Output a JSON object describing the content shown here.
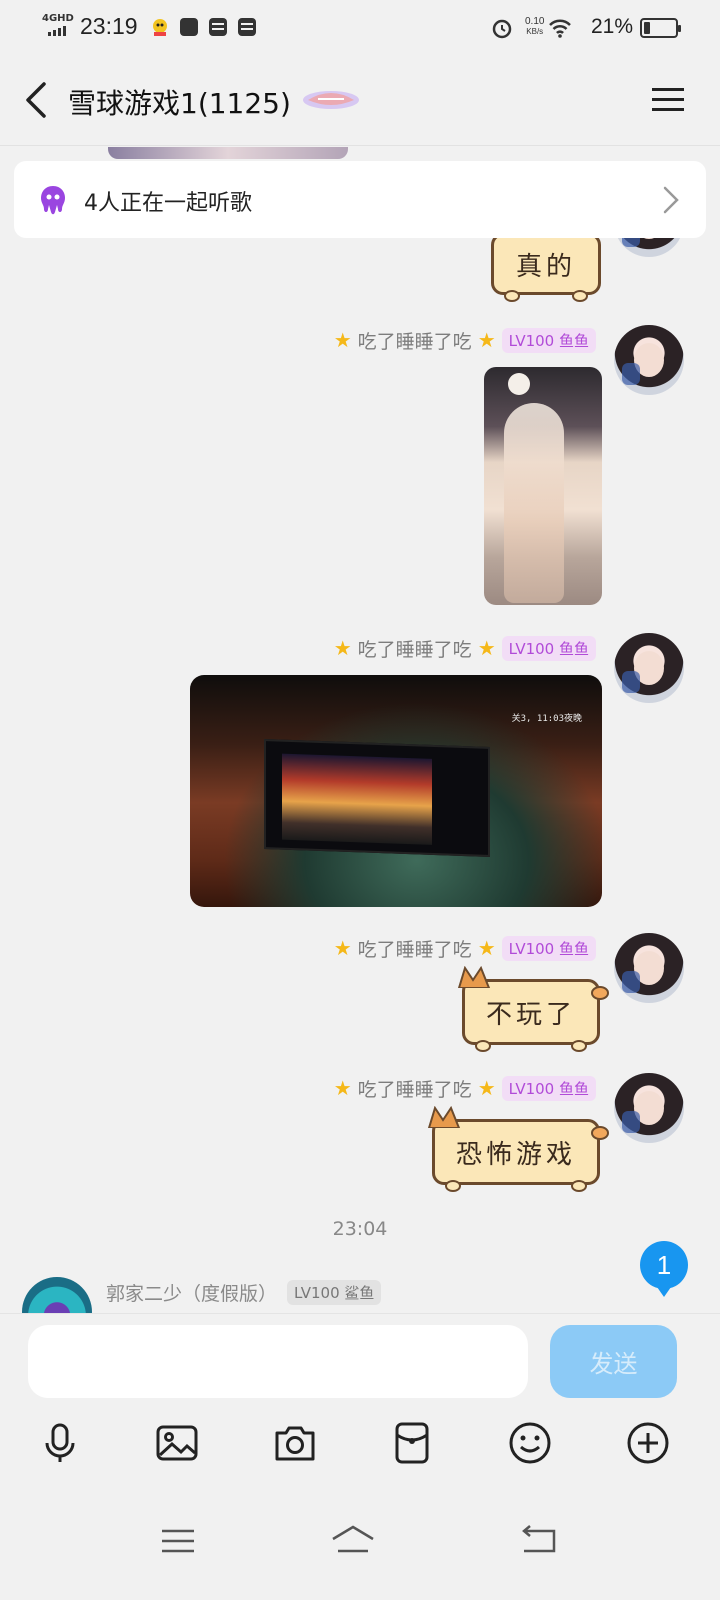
{
  "status_bar": {
    "network": "4GHD",
    "time": "23:19",
    "speed_value": "0.10",
    "speed_unit": "KB/s",
    "battery": "21%",
    "battery_level": 0.21
  },
  "header": {
    "title": "雪球游戏1(1125)"
  },
  "listen_banner": {
    "text": "4人正在一起听歌"
  },
  "messages": [
    {
      "sender": "吃了睡睡了吃",
      "level": "LV100 鱼鱼",
      "sticker_text": "真的"
    },
    {
      "sender": "吃了睡睡了吃",
      "level": "LV100 鱼鱼",
      "type": "image"
    },
    {
      "sender": "吃了睡睡了吃",
      "level": "LV100 鱼鱼",
      "type": "image",
      "osd": "关3, 11:03夜晚"
    },
    {
      "sender": "吃了睡睡了吃",
      "level": "LV100 鱼鱼",
      "sticker_text": "不玩了"
    },
    {
      "sender": "吃了睡睡了吃",
      "level": "LV100 鱼鱼",
      "sticker_text": "恐怖游戏"
    }
  ],
  "timestamp": "23:04",
  "peer": {
    "name": "郭家二少（度假版）",
    "level": "LV100 鲨鱼"
  },
  "unread_count": "1",
  "composer": {
    "placeholder": "",
    "send_label": "发送"
  },
  "toolbar_icons": [
    "microphone-icon",
    "image-icon",
    "camera-icon",
    "red-packet-icon",
    "emoji-icon",
    "plus-icon"
  ],
  "colors": {
    "accent": "#1896f0",
    "send_disabled": "#8ccaf6",
    "level_badge": "#b14bd8"
  }
}
